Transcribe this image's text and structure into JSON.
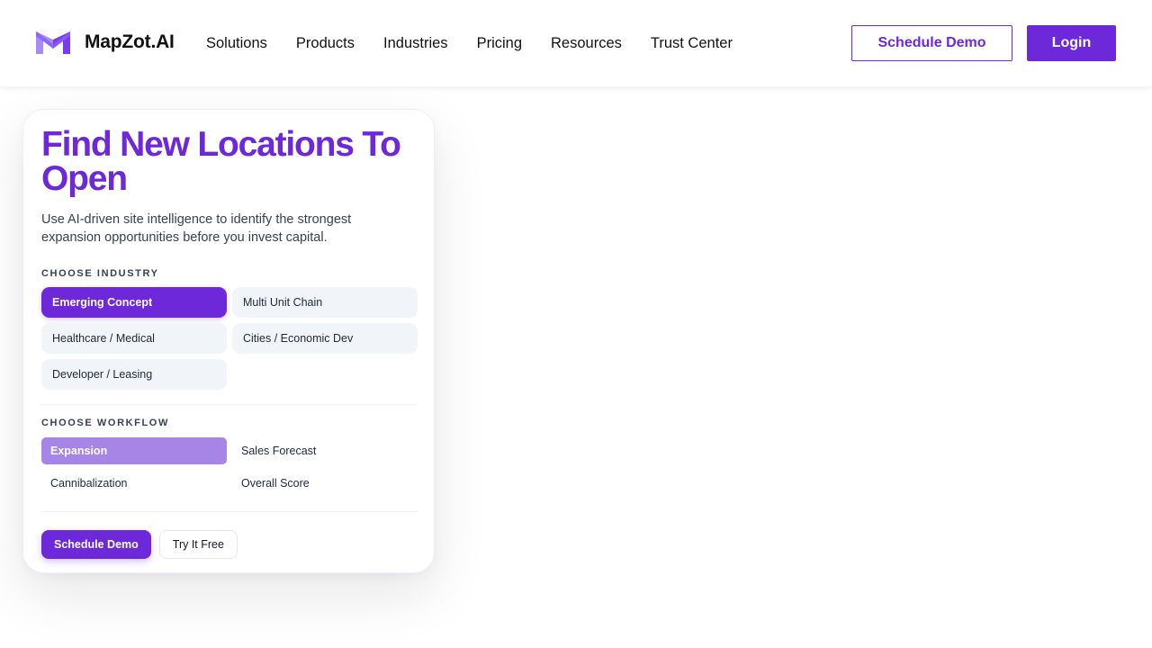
{
  "brand": {
    "name": "MapZot.AI",
    "logo_icon": "m-logo-icon",
    "accent_color": "#6d28d9"
  },
  "nav": {
    "items": [
      {
        "label": "Solutions"
      },
      {
        "label": "Products"
      },
      {
        "label": "Industries"
      },
      {
        "label": "Pricing"
      },
      {
        "label": "Resources"
      },
      {
        "label": "Trust Center"
      }
    ]
  },
  "header_actions": {
    "schedule_demo": "Schedule Demo",
    "login": "Login"
  },
  "card": {
    "title": "Find New Locations To Open",
    "subtitle": "Use AI-driven site intelligence to identify the strongest expansion opportunities before you invest capital.",
    "industry_label": "CHOOSE INDUSTRY",
    "industries": [
      {
        "label": "Emerging Concept",
        "selected": true
      },
      {
        "label": "Multi Unit Chain",
        "selected": false
      },
      {
        "label": "Healthcare / Medical",
        "selected": false
      },
      {
        "label": "Cities / Economic Dev",
        "selected": false
      },
      {
        "label": "Developer / Leasing",
        "selected": false
      }
    ],
    "workflow_label": "CHOOSE WORKFLOW",
    "workflows": [
      {
        "label": "Expansion",
        "selected": true
      },
      {
        "label": "Sales Forecast",
        "selected": false
      },
      {
        "label": "Cannibalization",
        "selected": false
      },
      {
        "label": "Overall Score",
        "selected": false
      }
    ],
    "primary_action": "Schedule Demo",
    "secondary_action": "Try It Free"
  }
}
